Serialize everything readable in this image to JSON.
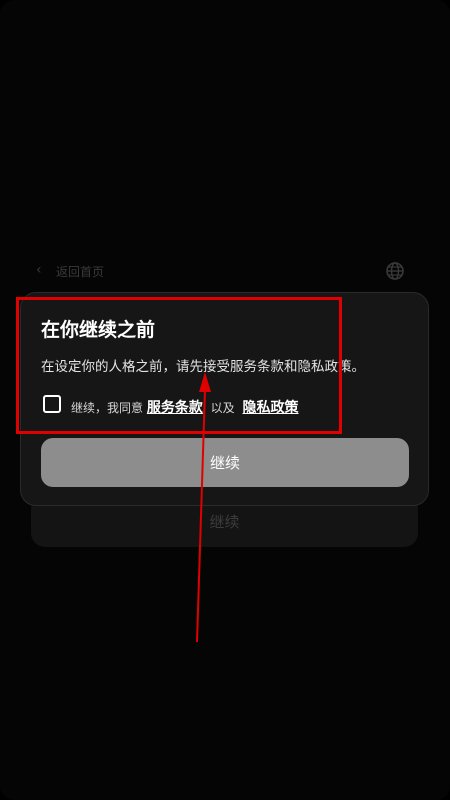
{
  "background": {
    "back_label": "返回首页",
    "continue_label": "继续"
  },
  "dialog": {
    "title": "在你继续之前",
    "description": "在设定你的人格之前，请先接受服务条款和隐私政策。",
    "consent": {
      "prefix": "继续，我同意",
      "terms_link": "服务条款",
      "separator": "以及",
      "privacy_link": "隐私政策",
      "checked": false
    },
    "continue_button": "继续"
  },
  "colors": {
    "annotation": "#e00000",
    "button_disabled": "#8d8d8d",
    "dialog_bg": "#161616"
  }
}
